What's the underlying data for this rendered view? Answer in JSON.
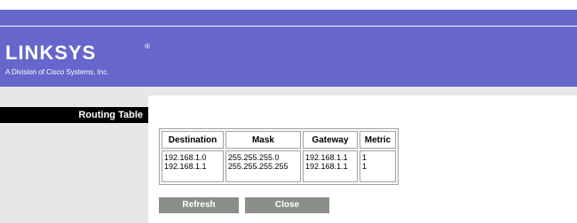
{
  "brand": {
    "logo": "LINKSYS",
    "registered": "®",
    "tagline": "A Division of Cisco Systems, Inc."
  },
  "colors": {
    "header": "#6666cc",
    "sidebar": "#e7e7e7",
    "section_label_bg": "#000000",
    "button": "#8a8f8a"
  },
  "sidebar": {
    "section_title": "Routing Table"
  },
  "table": {
    "headers": [
      "Destination",
      "Mask",
      "Gateway",
      "Metric"
    ],
    "rows": [
      {
        "destination": "192.168.1.0",
        "mask": "255.255.255.0",
        "gateway": "192.168.1.1",
        "metric": "1"
      },
      {
        "destination": "192.168.1.1",
        "mask": "255.255.255.255",
        "gateway": "192.168.1.1",
        "metric": "1"
      }
    ]
  },
  "buttons": {
    "refresh": "Refresh",
    "close": "Close"
  }
}
